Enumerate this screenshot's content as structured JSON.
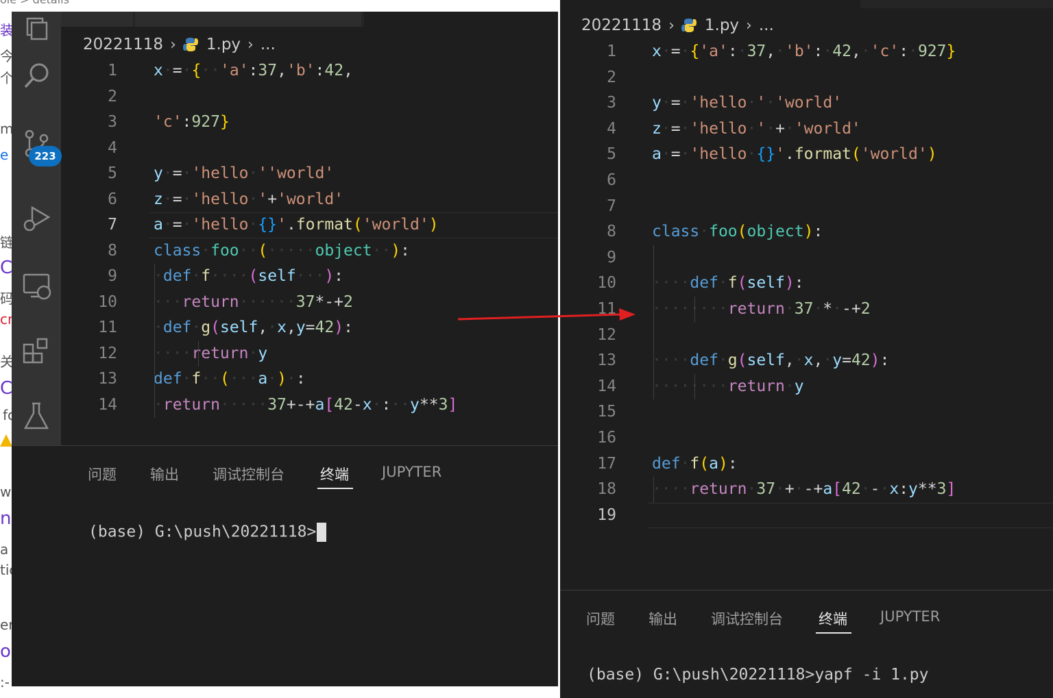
{
  "background": {
    "fragments": [
      "ole > details",
      "装",
      "今扌",
      "个ノ",
      "m",
      "e",
      "链",
      "C",
      "码E",
      "cr",
      "关",
      "C",
      "fc",
      "w",
      "n",
      "a",
      "tic",
      "er",
      "o",
      ":-"
    ]
  },
  "left": {
    "breadcrumb": {
      "folder": "20221118",
      "file": "1.py",
      "more": "..."
    },
    "badge": "223",
    "current_line": "7",
    "lines": [
      {
        "n": "1",
        "tokens": [
          [
            "id",
            "x"
          ],
          [
            "ws",
            "·"
          ],
          [
            "op",
            "="
          ],
          [
            "ws",
            "·"
          ],
          [
            "b1",
            "{"
          ],
          [
            "ws",
            "··"
          ],
          [
            "str",
            "'a'"
          ],
          [
            "op",
            ":"
          ],
          [
            "num",
            "37"
          ],
          [
            "op",
            ","
          ],
          [
            "str",
            "'b'"
          ],
          [
            "op",
            ":"
          ],
          [
            "num",
            "42"
          ],
          [
            "op",
            ","
          ]
        ]
      },
      {
        "n": "2",
        "tokens": []
      },
      {
        "n": "3",
        "tokens": [
          [
            "str",
            "'c'"
          ],
          [
            "op",
            ":"
          ],
          [
            "num",
            "927"
          ],
          [
            "b1",
            "}"
          ]
        ]
      },
      {
        "n": "4",
        "tokens": []
      },
      {
        "n": "5",
        "tokens": [
          [
            "id",
            "y"
          ],
          [
            "ws",
            "·"
          ],
          [
            "op",
            "="
          ],
          [
            "ws",
            "·"
          ],
          [
            "str",
            "'hello"
          ],
          [
            "ws",
            "·"
          ],
          [
            "str",
            "''world'"
          ]
        ]
      },
      {
        "n": "6",
        "tokens": [
          [
            "id",
            "z"
          ],
          [
            "ws",
            "·"
          ],
          [
            "op",
            "="
          ],
          [
            "ws",
            "·"
          ],
          [
            "str",
            "'hello"
          ],
          [
            "ws",
            "·"
          ],
          [
            "str",
            "'"
          ],
          [
            "op",
            "+"
          ],
          [
            "str",
            "'world'"
          ]
        ]
      },
      {
        "n": "7",
        "tokens": [
          [
            "id",
            "a"
          ],
          [
            "ws",
            "·"
          ],
          [
            "op",
            "="
          ],
          [
            "ws",
            "·"
          ],
          [
            "str",
            "'hello"
          ],
          [
            "ws",
            "·"
          ],
          [
            "b3",
            "{}"
          ],
          [
            "str",
            "'"
          ],
          [
            "op",
            "."
          ],
          [
            "fn",
            "format"
          ],
          [
            "b1",
            "("
          ],
          [
            "str",
            "'world'"
          ],
          [
            "b1",
            ")"
          ]
        ]
      },
      {
        "n": "8",
        "tokens": [
          [
            "kw",
            "class"
          ],
          [
            "ws",
            "·"
          ],
          [
            "cls",
            "foo"
          ],
          [
            "ws",
            "··"
          ],
          [
            "b1",
            "("
          ],
          [
            "ws",
            "·····"
          ],
          [
            "cls",
            "object"
          ],
          [
            "ws",
            "··"
          ],
          [
            "b1",
            ")"
          ],
          [
            "op",
            ":"
          ]
        ]
      },
      {
        "n": "9",
        "tokens": [
          [
            "ws",
            "·"
          ],
          [
            "kw",
            "def"
          ],
          [
            "ws",
            "·"
          ],
          [
            "fn",
            "f"
          ],
          [
            "ws",
            "····"
          ],
          [
            "b2",
            "("
          ],
          [
            "id",
            "self"
          ],
          [
            "ws",
            "···"
          ],
          [
            "b2",
            ")"
          ],
          [
            "op",
            ":"
          ]
        ]
      },
      {
        "n": "10",
        "tokens": [
          [
            "ws",
            "···"
          ],
          [
            "kw2",
            "return"
          ],
          [
            "ws",
            "······"
          ],
          [
            "num",
            "37"
          ],
          [
            "op",
            "*-+"
          ],
          [
            "num",
            "2"
          ]
        ]
      },
      {
        "n": "11",
        "tokens": [
          [
            "ws",
            "·"
          ],
          [
            "kw",
            "def"
          ],
          [
            "ws",
            "·"
          ],
          [
            "fn",
            "g"
          ],
          [
            "b2",
            "("
          ],
          [
            "id",
            "self"
          ],
          [
            "op",
            ","
          ],
          [
            "ws",
            "·"
          ],
          [
            "id",
            "x"
          ],
          [
            "op",
            ","
          ],
          [
            "id",
            "y"
          ],
          [
            "op",
            "="
          ],
          [
            "num",
            "42"
          ],
          [
            "b2",
            ")"
          ],
          [
            "op",
            ":"
          ]
        ]
      },
      {
        "n": "12",
        "tokens": [
          [
            "ws",
            "····"
          ],
          [
            "kw2",
            "return"
          ],
          [
            "ws",
            "·"
          ],
          [
            "id",
            "y"
          ]
        ]
      },
      {
        "n": "13",
        "tokens": [
          [
            "kw",
            "def"
          ],
          [
            "ws",
            "·"
          ],
          [
            "fn",
            "f"
          ],
          [
            "ws",
            "··"
          ],
          [
            "b1",
            "("
          ],
          [
            "ws",
            "···"
          ],
          [
            "id",
            "a"
          ],
          [
            "ws",
            "·"
          ],
          [
            "b1",
            ")"
          ],
          [
            "ws",
            "·"
          ],
          [
            "op",
            ":"
          ]
        ]
      },
      {
        "n": "14",
        "tokens": [
          [
            "ws",
            "·"
          ],
          [
            "kw2",
            "return"
          ],
          [
            "ws",
            "·····"
          ],
          [
            "num",
            "37"
          ],
          [
            "op",
            "+-+"
          ],
          [
            "id",
            "a"
          ],
          [
            "b2",
            "["
          ],
          [
            "num",
            "42"
          ],
          [
            "op",
            "-"
          ],
          [
            "id",
            "x"
          ],
          [
            "ws",
            "·"
          ],
          [
            "op",
            ":"
          ],
          [
            "ws",
            "··"
          ],
          [
            "id",
            "y"
          ],
          [
            "op",
            "**"
          ],
          [
            "num",
            "3"
          ],
          [
            "b2",
            "]"
          ]
        ]
      }
    ],
    "panel_tabs": [
      "问题",
      "输出",
      "调试控制台",
      "终端",
      "JUPYTER"
    ],
    "active_tab": "终端",
    "terminal": "(base) G:\\push\\20221118>"
  },
  "right": {
    "breadcrumb": {
      "folder": "20221118",
      "file": "1.py",
      "more": "..."
    },
    "current_line": "19",
    "lines": [
      {
        "n": "1",
        "tokens": [
          [
            "id",
            "x"
          ],
          [
            "ws",
            "·"
          ],
          [
            "op",
            "="
          ],
          [
            "ws",
            "·"
          ],
          [
            "b1",
            "{"
          ],
          [
            "str",
            "'a'"
          ],
          [
            "op",
            ":"
          ],
          [
            "ws",
            "·"
          ],
          [
            "num",
            "37"
          ],
          [
            "op",
            ","
          ],
          [
            "ws",
            "·"
          ],
          [
            "str",
            "'b'"
          ],
          [
            "op",
            ":"
          ],
          [
            "ws",
            "·"
          ],
          [
            "num",
            "42"
          ],
          [
            "op",
            ","
          ],
          [
            "ws",
            "·"
          ],
          [
            "str",
            "'c'"
          ],
          [
            "op",
            ":"
          ],
          [
            "ws",
            "·"
          ],
          [
            "num",
            "927"
          ],
          [
            "b1",
            "}"
          ]
        ]
      },
      {
        "n": "2",
        "tokens": []
      },
      {
        "n": "3",
        "tokens": [
          [
            "id",
            "y"
          ],
          [
            "ws",
            "·"
          ],
          [
            "op",
            "="
          ],
          [
            "ws",
            "·"
          ],
          [
            "str",
            "'hello"
          ],
          [
            "ws",
            "·"
          ],
          [
            "str",
            "'"
          ],
          [
            "ws",
            "·"
          ],
          [
            "str",
            "'world'"
          ]
        ]
      },
      {
        "n": "4",
        "tokens": [
          [
            "id",
            "z"
          ],
          [
            "ws",
            "·"
          ],
          [
            "op",
            "="
          ],
          [
            "ws",
            "·"
          ],
          [
            "str",
            "'hello"
          ],
          [
            "ws",
            "·"
          ],
          [
            "str",
            "'"
          ],
          [
            "ws",
            "·"
          ],
          [
            "op",
            "+"
          ],
          [
            "ws",
            "·"
          ],
          [
            "str",
            "'world'"
          ]
        ]
      },
      {
        "n": "5",
        "tokens": [
          [
            "id",
            "a"
          ],
          [
            "ws",
            "·"
          ],
          [
            "op",
            "="
          ],
          [
            "ws",
            "·"
          ],
          [
            "str",
            "'hello"
          ],
          [
            "ws",
            "·"
          ],
          [
            "b3",
            "{}"
          ],
          [
            "str",
            "'"
          ],
          [
            "op",
            "."
          ],
          [
            "fn",
            "format"
          ],
          [
            "b1",
            "("
          ],
          [
            "str",
            "'world'"
          ],
          [
            "b1",
            ")"
          ]
        ]
      },
      {
        "n": "6",
        "tokens": []
      },
      {
        "n": "7",
        "tokens": []
      },
      {
        "n": "8",
        "tokens": [
          [
            "kw",
            "class"
          ],
          [
            "ws",
            "·"
          ],
          [
            "cls",
            "foo"
          ],
          [
            "b1",
            "("
          ],
          [
            "cls",
            "object"
          ],
          [
            "b1",
            ")"
          ],
          [
            "op",
            ":"
          ]
        ]
      },
      {
        "n": "9",
        "tokens": []
      },
      {
        "n": "10",
        "tokens": [
          [
            "ws",
            "····"
          ],
          [
            "kw",
            "def"
          ],
          [
            "ws",
            "·"
          ],
          [
            "fn",
            "f"
          ],
          [
            "b2",
            "("
          ],
          [
            "id",
            "self"
          ],
          [
            "b2",
            ")"
          ],
          [
            "op",
            ":"
          ]
        ]
      },
      {
        "n": "11",
        "tokens": [
          [
            "ws",
            "········"
          ],
          [
            "kw2",
            "return"
          ],
          [
            "ws",
            "·"
          ],
          [
            "num",
            "37"
          ],
          [
            "ws",
            "·"
          ],
          [
            "op",
            "*"
          ],
          [
            "ws",
            "·"
          ],
          [
            "op",
            "-+"
          ],
          [
            "num",
            "2"
          ]
        ]
      },
      {
        "n": "12",
        "tokens": []
      },
      {
        "n": "13",
        "tokens": [
          [
            "ws",
            "····"
          ],
          [
            "kw",
            "def"
          ],
          [
            "ws",
            "·"
          ],
          [
            "fn",
            "g"
          ],
          [
            "b2",
            "("
          ],
          [
            "id",
            "self"
          ],
          [
            "op",
            ","
          ],
          [
            "ws",
            "·"
          ],
          [
            "id",
            "x"
          ],
          [
            "op",
            ","
          ],
          [
            "ws",
            "·"
          ],
          [
            "id",
            "y"
          ],
          [
            "op",
            "="
          ],
          [
            "num",
            "42"
          ],
          [
            "b2",
            ")"
          ],
          [
            "op",
            ":"
          ]
        ]
      },
      {
        "n": "14",
        "tokens": [
          [
            "ws",
            "········"
          ],
          [
            "kw2",
            "return"
          ],
          [
            "ws",
            "·"
          ],
          [
            "id",
            "y"
          ]
        ]
      },
      {
        "n": "15",
        "tokens": []
      },
      {
        "n": "16",
        "tokens": []
      },
      {
        "n": "17",
        "tokens": [
          [
            "kw",
            "def"
          ],
          [
            "ws",
            "·"
          ],
          [
            "fn",
            "f"
          ],
          [
            "b1",
            "("
          ],
          [
            "id",
            "a"
          ],
          [
            "b1",
            ")"
          ],
          [
            "op",
            ":"
          ]
        ]
      },
      {
        "n": "18",
        "tokens": [
          [
            "ws",
            "····"
          ],
          [
            "kw2",
            "return"
          ],
          [
            "ws",
            "·"
          ],
          [
            "num",
            "37"
          ],
          [
            "ws",
            "·"
          ],
          [
            "op",
            "+"
          ],
          [
            "ws",
            "·"
          ],
          [
            "op",
            "-+"
          ],
          [
            "id",
            "a"
          ],
          [
            "b2",
            "["
          ],
          [
            "num",
            "42"
          ],
          [
            "ws",
            "·"
          ],
          [
            "op",
            "-"
          ],
          [
            "ws",
            "·"
          ],
          [
            "id",
            "x"
          ],
          [
            "op",
            ":"
          ],
          [
            "id",
            "y"
          ],
          [
            "op",
            "**"
          ],
          [
            "num",
            "3"
          ],
          [
            "b2",
            "]"
          ]
        ]
      },
      {
        "n": "19",
        "tokens": []
      }
    ],
    "panel_tabs": [
      "问题",
      "输出",
      "调试控制台",
      "终端",
      "JUPYTER"
    ],
    "active_tab": "终端",
    "terminal": "(base) G:\\push\\20221118>yapf -i 1.py"
  },
  "activity_icons": [
    "explorer-icon",
    "search-icon",
    "source-control-icon",
    "run-debug-icon",
    "remote-explorer-icon",
    "extensions-icon",
    "testing-icon",
    "docker-icon",
    "json-icon"
  ],
  "colors": {
    "editor_bg": "#1e1e1e",
    "activity_bg": "#333333",
    "badge": "#0e70c0",
    "arrow": "#e02020"
  }
}
